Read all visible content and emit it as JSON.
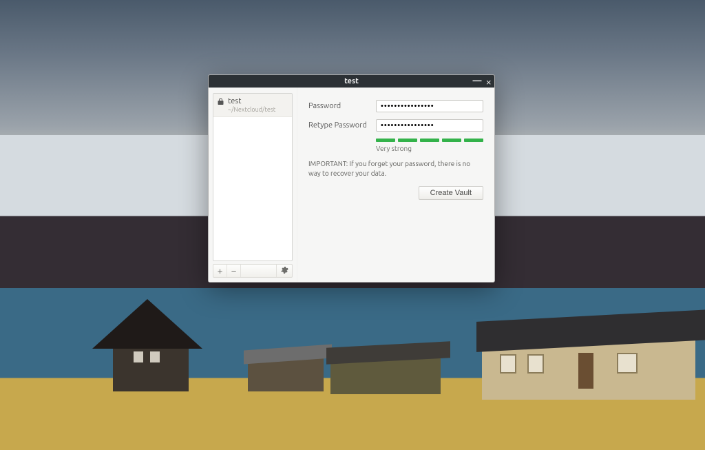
{
  "window": {
    "title": "test"
  },
  "sidebar": {
    "vault_name": "test",
    "vault_path": "~/Nextcloud/test"
  },
  "form": {
    "password_label": "Password",
    "retype_label": "Retype Password",
    "password_value": "••••••••••••••••",
    "retype_value": "••••••••••••••••",
    "strength_label": "Very strong",
    "important_text": "IMPORTANT: If you forget your password, there is no way to recover your data.",
    "create_label": "Create Vault"
  }
}
